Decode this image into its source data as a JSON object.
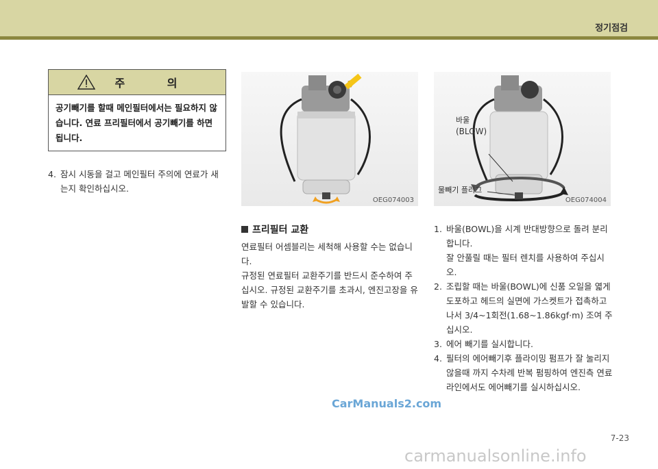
{
  "header": {
    "section": "정기점검"
  },
  "caution": {
    "title": "주 의",
    "body": "공기빼기를 할때 메인필터에서는 필요하지 않습니다. 연료 프리필터에서 공기빼기를 하면 됩니다."
  },
  "left_steps": [
    {
      "num": "4.",
      "text": "잠시 시동을 걸고 메인필터 주의에 연료가 새는지 확인하십시오."
    }
  ],
  "photo1": {
    "code": "OEG074003"
  },
  "photo2": {
    "code": "OEG074004",
    "label_bowl_kr": "바울",
    "label_bowl_en": "(BLOW)",
    "label_plug": "물빼기 플러그"
  },
  "middle": {
    "heading": "프리필터 교환",
    "paragraphs": [
      "연료필터 어셈블리는 세척해 사용할 수는 없습니다.",
      "규정된 연료필터 교환주기를 반드시 준수하여 주십시오. 규정된 교환주기를 초과시, 엔진고장을 유발할 수 있습니다."
    ]
  },
  "right_steps": [
    {
      "num": "1.",
      "text": "바울(BOWL)을 시계 반대방향으로 돌려 분리합니다."
    },
    {
      "num": "",
      "text": "잘 안풀릴 때는 필터 렌치를 사용하여 주십시오."
    },
    {
      "num": "2.",
      "text": "조립할 때는 바울(BOWL)에 신품 오일을 엷게 도포하고 헤드의 실면에 가스켓트가 접촉하고 나서 3/4~1회전(1.68~1.86kgf·m) 조여 주십시오."
    },
    {
      "num": "3.",
      "text": "에어 빼기를 실시합니다."
    },
    {
      "num": "4.",
      "text": "필터의 에어빼기후 플라이밍 펌프가 잘 눌리지 않을때 까지 수차례 반복 펌핑하여 엔진측 연료 라인에서도 에어빼기를 실시하십시오."
    }
  ],
  "watermark1": "CarManuals2.com",
  "watermark2": "carmanualsonline.info",
  "page_number": "7-23"
}
